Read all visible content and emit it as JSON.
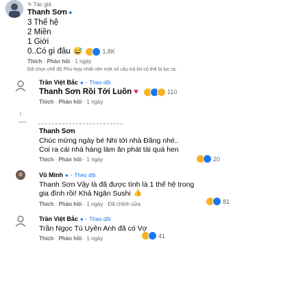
{
  "main_comment": {
    "badge": "Tác giả",
    "author": "Thanh Sơn",
    "lines": [
      "3 Thế hệ",
      "2 Miền",
      "1 Giới",
      "0..Có gì đâu"
    ],
    "reaction_count": "1,8K",
    "actions": {
      "like": "Thích",
      "reply": "Phản hồi",
      "time": "1 ngày"
    }
  },
  "filter_notice": "Đã chọn chế độ Phù hợp nhất nên một số câu trả lời có thể bị lọc ra.",
  "replies": [
    {
      "author": "Trần Việt Bắc",
      "follow": "Theo dõi",
      "text": "Thanh Sơn Rồi Tới Luôn",
      "reaction_count": "110",
      "actions": {
        "like": "Thích",
        "reply": "Phản hồi",
        "time": "1 ngày"
      }
    },
    {
      "author": "Thanh Sơn",
      "text_lines": [
        "Chúc mừng ngày bé Nhi tới nhà Đăng nhé..",
        "Coi ra cái nhà hàng làm ăn phát tài quá hen"
      ],
      "reaction_count": "20",
      "actions": {
        "like": "Thích",
        "reply": "Phản hồi",
        "time": "1 ngày"
      }
    },
    {
      "author": "Vũ Minh",
      "follow": "Theo dõi",
      "text_lines": [
        "Thanh Sơn Vậy là đã được tính là 1 thế hệ trong",
        "gia đình rồi! Khả Ngân Sushi"
      ],
      "reaction_count": "81",
      "actions": {
        "like": "Thích",
        "reply": "Phản hồi",
        "time": "1 ngày",
        "edited": "Đã chỉnh sửa"
      }
    },
    {
      "author": "Trần Việt Bắc",
      "follow": "Theo dõi",
      "text": "Trần Ngọc Tú Uyên Anh đã có Vợ",
      "reaction_count": "41",
      "actions": {
        "like": "Thích",
        "reply": "Phản hồi",
        "time": "1 ngày"
      }
    }
  ]
}
